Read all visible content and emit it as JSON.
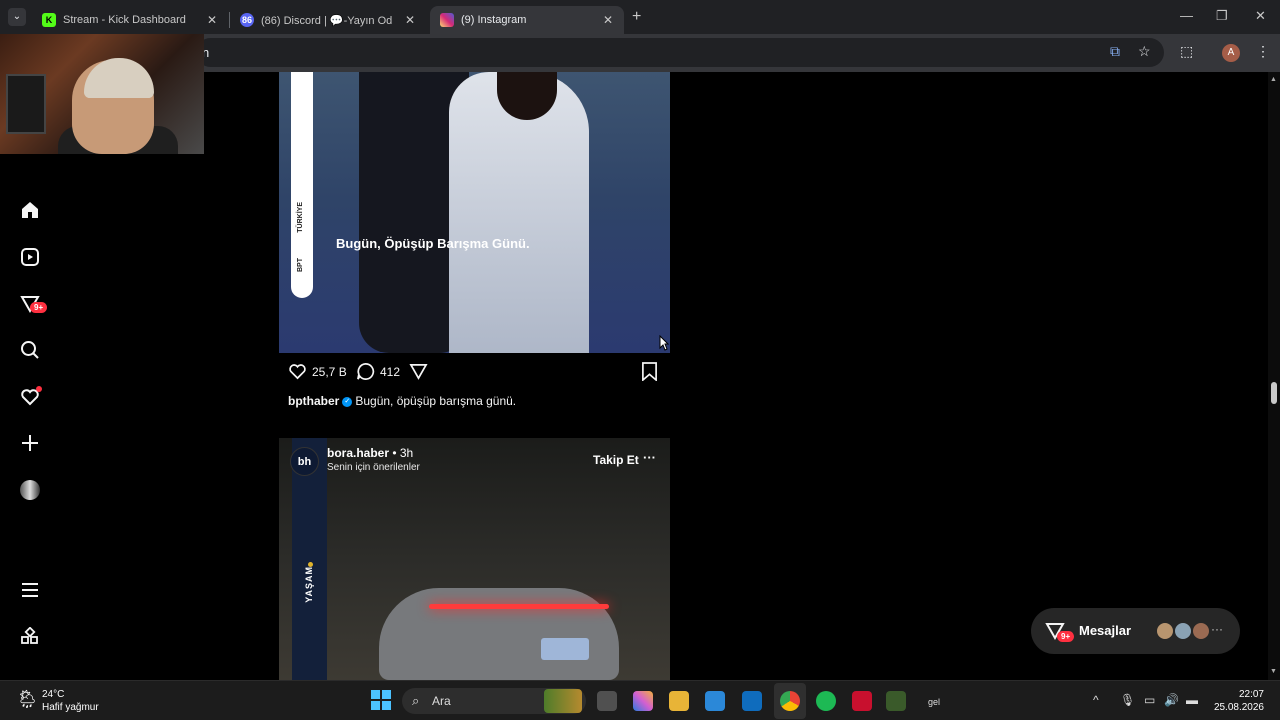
{
  "browser": {
    "tabs": [
      {
        "title": "Stream - Kick Dashboard",
        "favicon": "K",
        "favicon_color": "#53fc18"
      },
      {
        "title": "(86) Discord | 💬-Yayın Od",
        "favicon": "86",
        "favicon_color": "#5865f2"
      },
      {
        "title": "(9) Instagram",
        "favicon": "ig",
        "favicon_color": "#d62976"
      }
    ],
    "new_tab": "+",
    "omnibox_text": "n",
    "profile_initial": "A"
  },
  "sidebar": {
    "icons": [
      "home-icon",
      "reels-icon",
      "messages-icon",
      "search-icon",
      "notifications-icon",
      "create-icon",
      "profile-icon",
      "menu-icon",
      "apps-icon"
    ],
    "messages_badge": "9+"
  },
  "post1": {
    "overlay_text": "Bugün, Öpüşüp Barışma Günü.",
    "brand_vertical": "TÜRKİYE",
    "brand_logo": "BPT",
    "likes": "25,7 B",
    "comments": "412",
    "username": "bpthaber",
    "caption": "Bugün, öpüşüp barışma günü."
  },
  "post2": {
    "avatar_text": "bh",
    "username": "bora.haber",
    "time": " • 3h",
    "subtitle": "Senin için önerilenler",
    "follow_label": "Takip Et",
    "more": "···",
    "tag": "YAŞAM"
  },
  "messages": {
    "label": "Mesajlar",
    "badge": "9+"
  },
  "taskbar": {
    "temperature": "24°C",
    "weather": "Hafif yağmur",
    "search_placeholder": "Ara",
    "time": "22:07",
    "date": "25.08.2026",
    "extra_label": "gel"
  }
}
